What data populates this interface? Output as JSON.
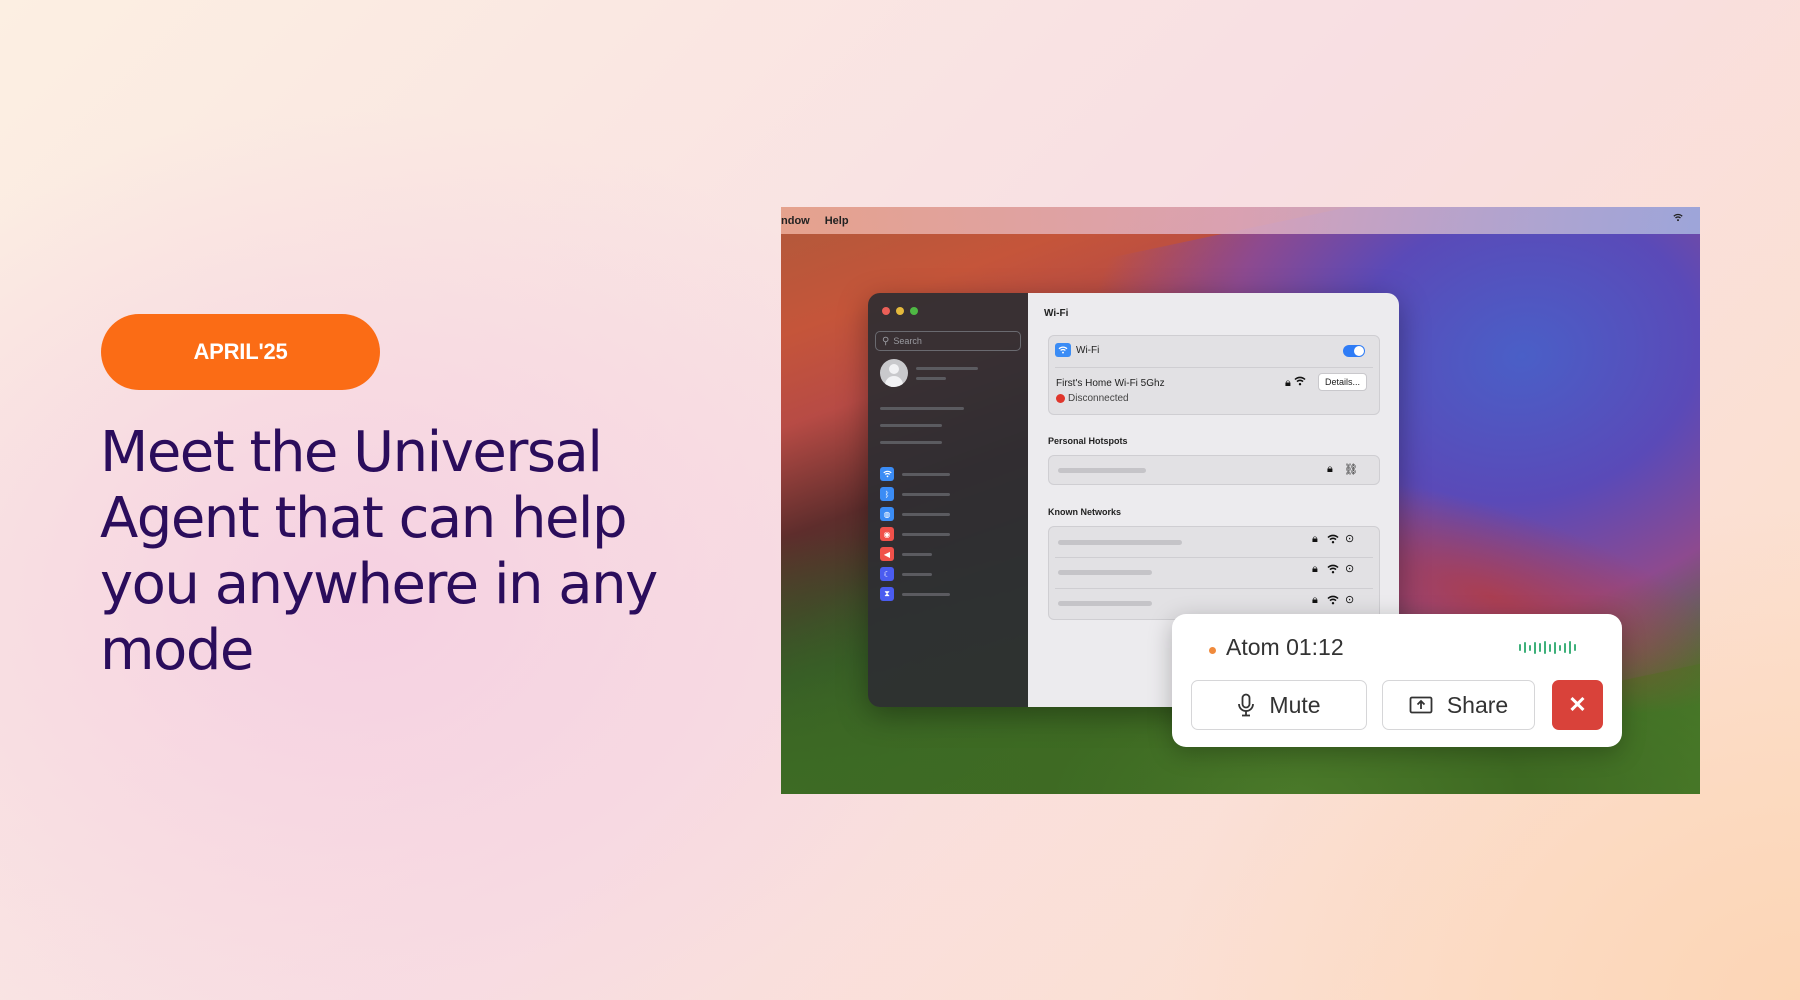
{
  "badge": {
    "label": "APRIL'25"
  },
  "headline": "Meet the Universal Agent that can help you anywhere in any mode",
  "screenshot": {
    "menubar": {
      "items": [
        "ndow",
        "Help"
      ]
    },
    "sidebar": {
      "search_placeholder": "Search",
      "items": [
        {
          "icon": "wifi-icon",
          "color": "#3b8cf5"
        },
        {
          "icon": "bluetooth-icon",
          "color": "#3b8cf5"
        },
        {
          "icon": "network-icon",
          "color": "#3b8cf5"
        },
        {
          "icon": "notifications-icon",
          "color": "#f0514a"
        },
        {
          "icon": "sound-icon",
          "color": "#f0514a"
        },
        {
          "icon": "focus-moon-icon",
          "color": "#4a5cf0"
        },
        {
          "icon": "screen-time-icon",
          "color": "#4a5cf0"
        }
      ]
    },
    "wifi": {
      "title": "Wi-Fi",
      "toggle_label": "Wi-Fi",
      "toggle_on": true,
      "network_name": "First's Home Wi-Fi 5Ghz",
      "status": "Disconnected",
      "details_button": "Details...",
      "personal_hotspots_label": "Personal Hotspots",
      "known_networks_label": "Known Networks"
    }
  },
  "call": {
    "title": "Atom 01:12",
    "mute_label": "Mute",
    "share_label": "Share",
    "end_label": "✕"
  },
  "colors": {
    "accent": "#fb6c15",
    "headline": "#2b0d5c",
    "end_call": "#d9423a",
    "waveform": "#3eb07a"
  }
}
